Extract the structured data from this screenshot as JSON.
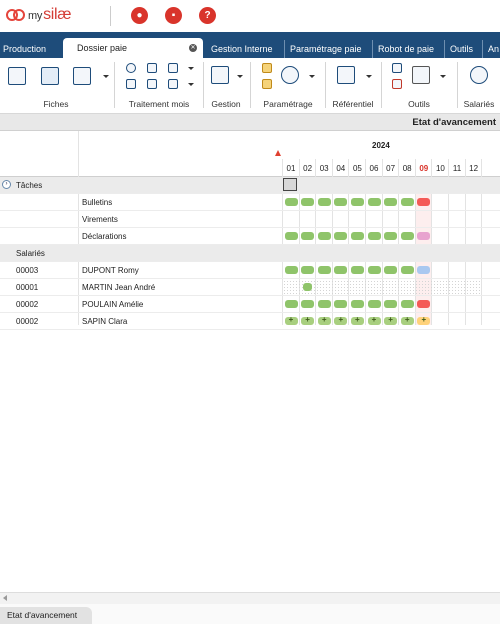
{
  "app": {
    "logo_prefix": "my",
    "logo_text": "silæ"
  },
  "tabs": [
    {
      "label": "Production"
    },
    {
      "label": "Dossier paie"
    },
    {
      "label": "Gestion Interne"
    },
    {
      "label": "Paramétrage paie"
    },
    {
      "label": "Robot de paie"
    },
    {
      "label": "Outils"
    },
    {
      "label": "An"
    }
  ],
  "ribbon": {
    "groups": [
      {
        "label": "Fiches"
      },
      {
        "label": "Traitement mois"
      },
      {
        "label": "Gestion"
      },
      {
        "label": "Paramétrage"
      },
      {
        "label": "Référentiel"
      },
      {
        "label": "Outils"
      },
      {
        "label": "Salariés"
      }
    ]
  },
  "page": {
    "title": "Etat d'avancement"
  },
  "grid": {
    "year": "2024",
    "months": [
      "01",
      "02",
      "03",
      "04",
      "05",
      "06",
      "07",
      "08",
      "09",
      "10",
      "11",
      "12"
    ],
    "current_month_index": 8,
    "sections": {
      "tasks": "Tâches",
      "employees": "Salariés"
    },
    "task_rows": [
      {
        "name": "Bulletins",
        "statuses": [
          "done",
          "done",
          "done",
          "done",
          "done",
          "done",
          "done",
          "done",
          "error"
        ]
      },
      {
        "name": "Virements",
        "statuses": []
      },
      {
        "name": "Déclarations",
        "statuses": [
          "done",
          "done",
          "done",
          "done",
          "done",
          "done",
          "done",
          "done",
          "pending"
        ]
      }
    ],
    "employee_rows": [
      {
        "code": "00003",
        "name": "DUPONT Romy",
        "statuses": [
          "done",
          "done",
          "done",
          "done",
          "done",
          "done",
          "done",
          "done",
          "info"
        ]
      },
      {
        "code": "00001",
        "name": "MARTIN Jean André",
        "statuses": [
          "none",
          "entry"
        ]
      },
      {
        "code": "00002",
        "name": "POULAIN Amélie",
        "statuses": [
          "done",
          "done",
          "done",
          "done",
          "done",
          "done",
          "done",
          "done",
          "error"
        ]
      },
      {
        "code": "00002",
        "name": "SAPIN Clara",
        "statuses": [
          "plus",
          "plus",
          "plus",
          "plus",
          "plus",
          "plus",
          "plus",
          "plus",
          "warn"
        ]
      }
    ],
    "colors": {
      "done": "#8fc46a",
      "error": "#f45a57",
      "pending": "#e8a3cf",
      "info": "#a9c8f0",
      "plus": "#a8cf7f",
      "warn": "#ffd27a",
      "entry": "#8fc46a"
    }
  },
  "bottom_tab": {
    "label": "Etat d'avancement"
  }
}
